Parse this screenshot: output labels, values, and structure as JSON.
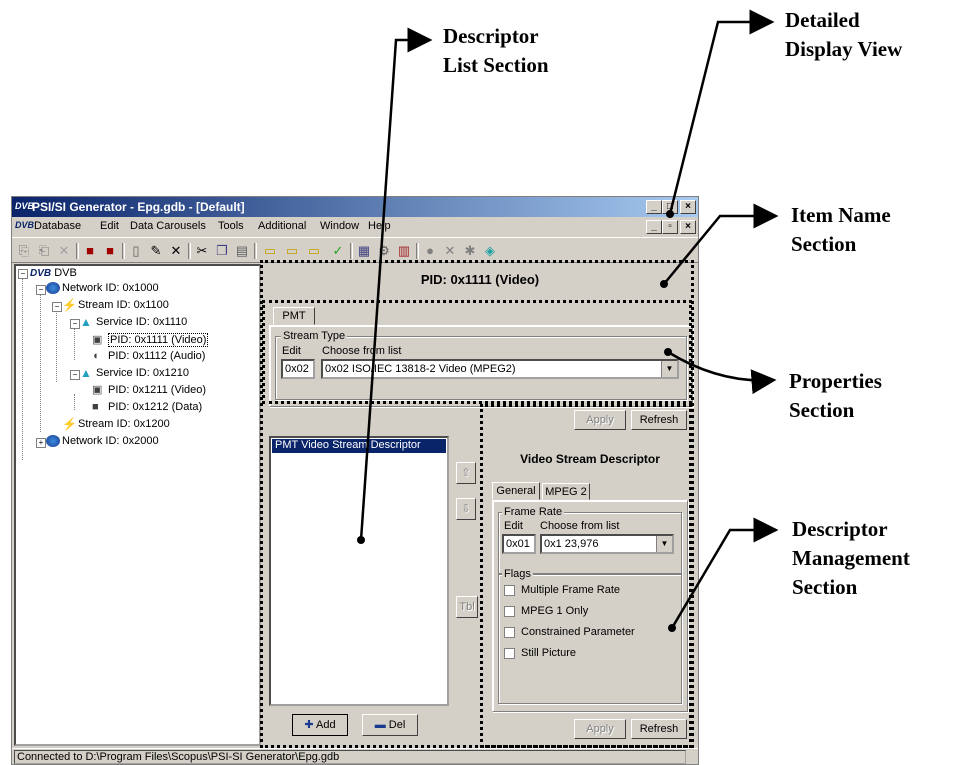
{
  "callouts": {
    "descriptor_list": "Descriptor List Section",
    "descriptor_list_l1": "Descriptor",
    "descriptor_list_l2": "List Section",
    "detailed_l1": "Detailed",
    "detailed_l2": "Display View",
    "item_name_l1": "Item Name",
    "item_name_l2": "Section",
    "properties_l1": "Properties",
    "properties_l2": "Section",
    "mgmt_l1": "Descriptor",
    "mgmt_l2": "Management",
    "mgmt_l3": "Section"
  },
  "window": {
    "title": "PSI/SI Generator - Epg.gdb - [Default]",
    "app_icon": "DVB"
  },
  "menu": [
    "Database",
    "Edit",
    "Data Carousels",
    "Tools",
    "Additional",
    "Window",
    "Help"
  ],
  "tree": {
    "root": "DVB",
    "n1": "Network ID: 0x1000",
    "n2": "Stream ID: 0x1100",
    "n3": "Service ID: 0x1110",
    "n4": "PID: 0x1111 (Video)",
    "n5": "PID: 0x1112 (Audio)",
    "n6": "Service ID: 0x1210",
    "n7": "PID: 0x1211 (Video)",
    "n8": "PID: 0x1212 (Data)",
    "n9": "Stream ID: 0x1200",
    "n10": "Network ID: 0x2000"
  },
  "detail": {
    "title": "PID: 0x1111 (Video)",
    "tab": "PMT",
    "stream_type_legend": "Stream Type",
    "edit_label": "Edit",
    "choose_label": "Choose from list",
    "edit_value": "0x02",
    "choose_value": "0x02 ISO/IEC 13818-2 Video (MPEG2)",
    "apply": "Apply",
    "refresh": "Refresh"
  },
  "descriptors": {
    "items": [
      "PMT Video Stream Descriptor"
    ],
    "tbl": "Tbl",
    "add": "Add",
    "del": "Del"
  },
  "descriptor_detail": {
    "title": "Video Stream Descriptor",
    "tab_general": "General",
    "tab_mpeg2": "MPEG 2",
    "frame_rate_legend": "Frame Rate",
    "edit_label": "Edit",
    "choose_label": "Choose from list",
    "edit_value": "0x01",
    "choose_value": "0x1 23,976",
    "flags_legend": "Flags",
    "flags": [
      "Multiple Frame Rate",
      "MPEG 1 Only",
      "Constrained Parameter",
      "Still Picture"
    ],
    "apply": "Apply",
    "refresh": "Refresh"
  },
  "status": "Connected to D:\\Program Files\\Scopus\\PSI-SI Generator\\Epg.gdb"
}
